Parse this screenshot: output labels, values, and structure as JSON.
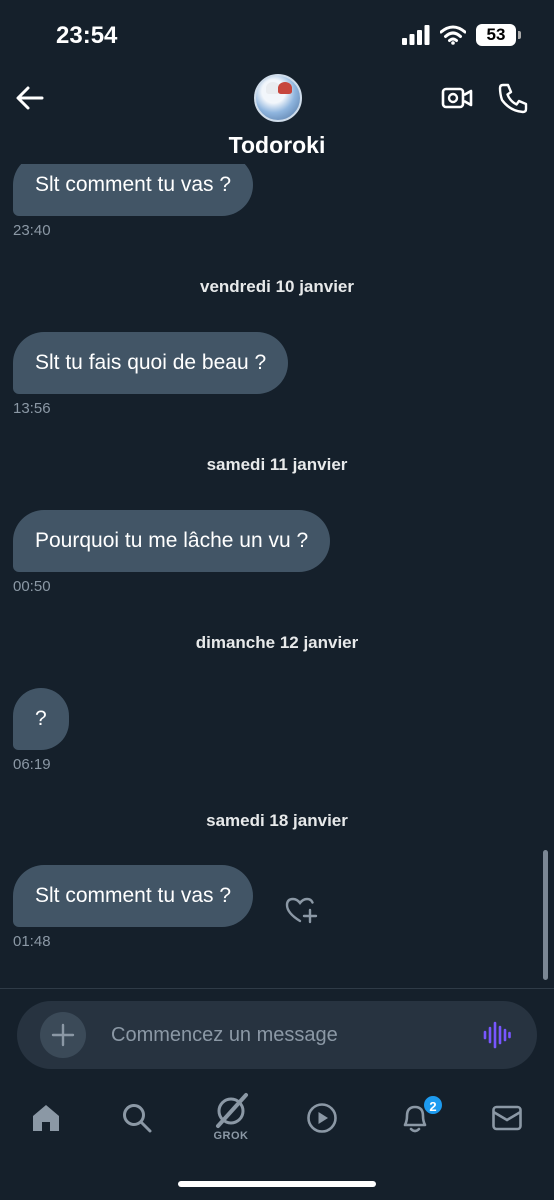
{
  "status_bar": {
    "time": "23:54",
    "battery": "53"
  },
  "header": {
    "contact_name": "Todoroki"
  },
  "messages": [
    {
      "text": "Slt comment tu vas ?",
      "time": "23:40"
    },
    {
      "date": "vendredi 10 janvier"
    },
    {
      "text": "Slt tu fais quoi de beau ?",
      "time": "13:56"
    },
    {
      "date": "samedi 11 janvier"
    },
    {
      "text": "Pourquoi tu me lâche un vu ?",
      "time": "00:50"
    },
    {
      "date": "dimanche 12 janvier"
    },
    {
      "text": "?",
      "time": "06:19"
    },
    {
      "date": "samedi 18 janvier"
    },
    {
      "text": "Slt comment tu vas ?",
      "time": "01:48"
    }
  ],
  "composer": {
    "placeholder": "Commencez un message"
  },
  "tabbar": {
    "grok_label": "GROK",
    "notifications_badge": "2"
  },
  "icons": {
    "back": "arrow-left-icon",
    "video": "video-camera-icon",
    "call": "phone-icon",
    "add": "plus-icon",
    "voice": "waveform-icon",
    "react": "heart-plus-icon",
    "home": "home-icon",
    "search": "search-icon",
    "grok": "grok-icon",
    "video_tab": "play-circle-icon",
    "notifications": "bell-icon",
    "messages": "envelope-icon"
  },
  "colors": {
    "background": "#15202b",
    "bubble": "#425566",
    "accent": "#1d9bf0",
    "voice": "#7856ff"
  }
}
